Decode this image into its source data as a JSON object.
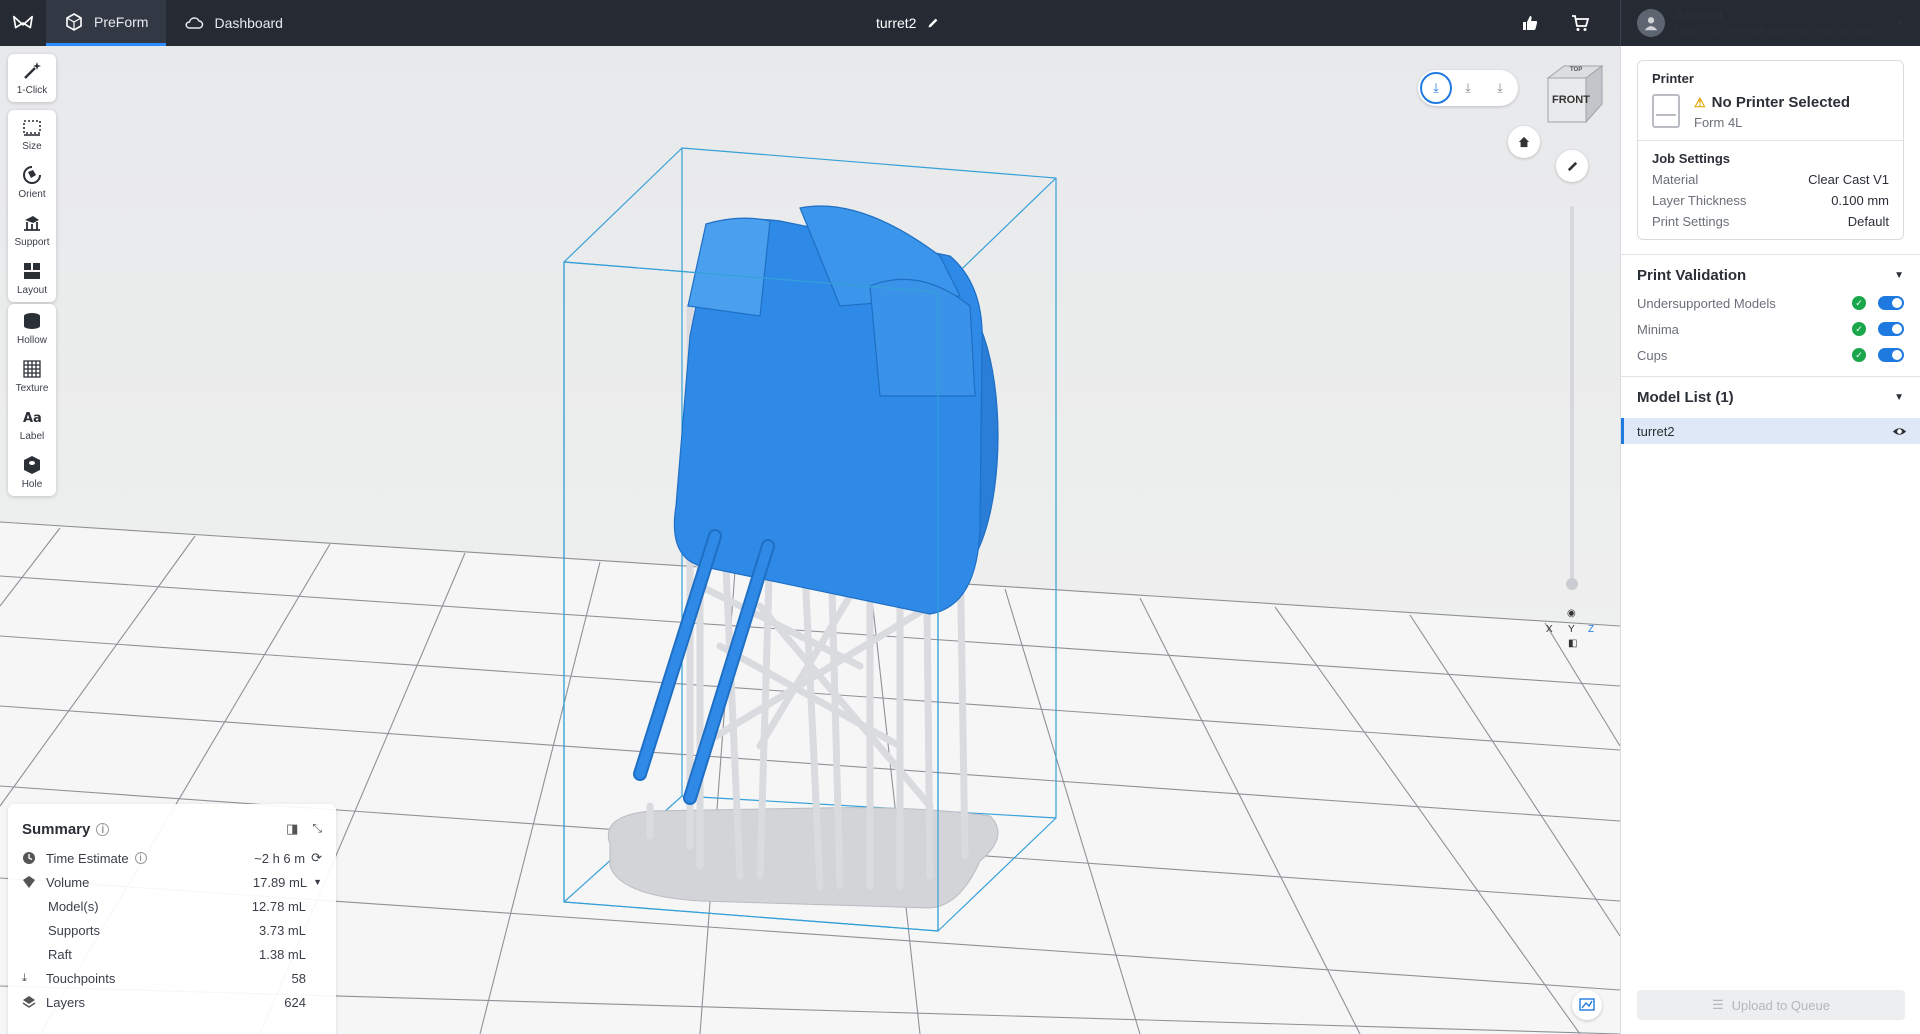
{
  "topbar": {
    "tabs": [
      {
        "label": "PreForm",
        "icon": "preform-icon"
      },
      {
        "label": "Dashboard",
        "icon": "cloud-icon"
      }
    ],
    "document_title": "turret2",
    "account": {
      "title": "Account",
      "subtitle": "Log in for remote printers and groups"
    }
  },
  "toolbar": {
    "groups": [
      [
        {
          "label": "1-Click",
          "icon": "magic-wand-icon"
        }
      ],
      [
        {
          "label": "Size",
          "icon": "size-icon"
        },
        {
          "label": "Orient",
          "icon": "orient-icon"
        },
        {
          "label": "Support",
          "icon": "support-icon"
        },
        {
          "label": "Layout",
          "icon": "layout-icon"
        }
      ],
      [
        {
          "label": "Hollow",
          "icon": "hollow-icon"
        },
        {
          "label": "Texture",
          "icon": "texture-icon"
        },
        {
          "label": "Label",
          "icon": "label-icon"
        },
        {
          "label": "Hole",
          "icon": "hole-icon"
        }
      ]
    ]
  },
  "viewcube": {
    "front": "FRONT",
    "top": "TOP"
  },
  "axes": {
    "x": "X",
    "y": "Y",
    "z": "Z"
  },
  "summary": {
    "title": "Summary",
    "rows": [
      {
        "label": "Time Estimate",
        "value": "~2 h 6 m",
        "icon": "clock-icon"
      },
      {
        "label": "Volume",
        "value": "17.89 mL",
        "icon": "volume-icon"
      },
      {
        "label": "Model(s)",
        "value": "12.78 mL"
      },
      {
        "label": "Supports",
        "value": "3.73 mL"
      },
      {
        "label": "Raft",
        "value": "1.38 mL"
      },
      {
        "label": "Touchpoints",
        "value": "58",
        "icon": "touchpoint-icon"
      },
      {
        "label": "Layers",
        "value": "624",
        "icon": "layers-icon"
      }
    ]
  },
  "panel": {
    "printer": {
      "label": "Printer",
      "name": "No Printer Selected",
      "model": "Form 4L"
    },
    "job_settings": {
      "label": "Job Settings",
      "rows": [
        {
          "key": "Material",
          "value": "Clear Cast V1"
        },
        {
          "key": "Layer Thickness",
          "value": "0.100 mm"
        },
        {
          "key": "Print Settings",
          "value": "Default"
        }
      ]
    },
    "validation": {
      "title": "Print Validation",
      "items": [
        "Undersupported Models",
        "Minima",
        "Cups"
      ]
    },
    "models": {
      "title": "Model List (1)",
      "items": [
        "turret2"
      ]
    },
    "upload_label": "Upload to Queue"
  },
  "colors": {
    "accent": "#1f7ae0",
    "model": "#2e8ae6",
    "support": "#d4d6da",
    "topbar": "#262b33"
  }
}
